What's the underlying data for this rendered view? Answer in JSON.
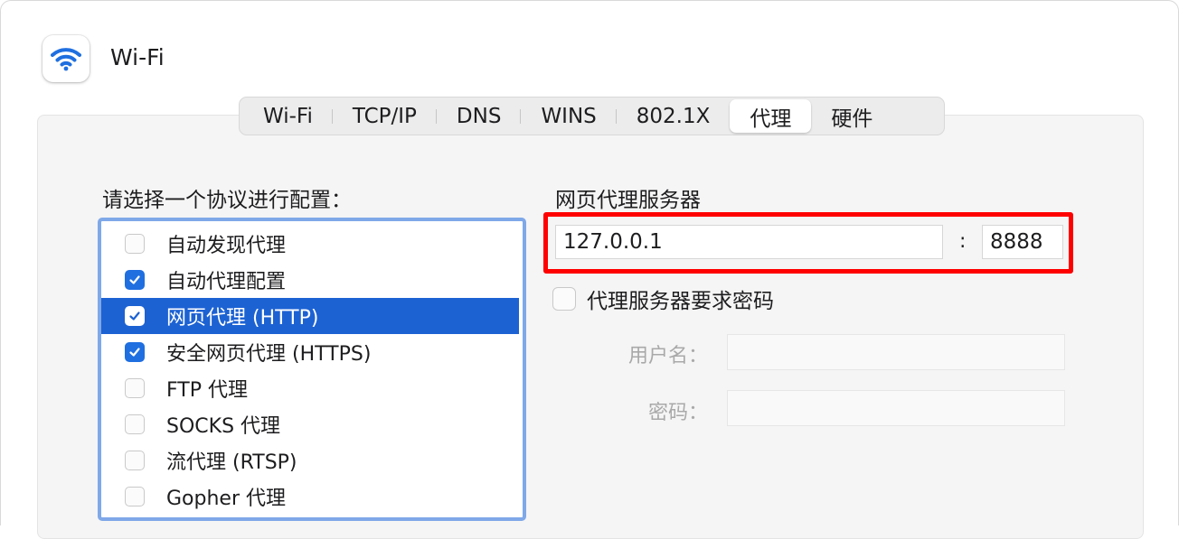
{
  "header": {
    "title": "Wi-Fi",
    "icon": "wifi-icon",
    "accent": "#1f6fe0"
  },
  "tabs": [
    {
      "label": "Wi-Fi",
      "active": false
    },
    {
      "label": "TCP/IP",
      "active": false
    },
    {
      "label": "DNS",
      "active": false
    },
    {
      "label": "WINS",
      "active": false
    },
    {
      "label": "802.1X",
      "active": false
    },
    {
      "label": "代理",
      "active": true
    },
    {
      "label": "硬件",
      "active": false
    }
  ],
  "protocol_list": {
    "label": "请选择一个协议进行配置：",
    "items": [
      {
        "label": "自动发现代理",
        "checked": false,
        "selected": false
      },
      {
        "label": "自动代理配置",
        "checked": true,
        "selected": false
      },
      {
        "label": "网页代理 (HTTP)",
        "checked": true,
        "selected": true
      },
      {
        "label": "安全网页代理 (HTTPS)",
        "checked": true,
        "selected": false
      },
      {
        "label": "FTP 代理",
        "checked": false,
        "selected": false
      },
      {
        "label": "SOCKS 代理",
        "checked": false,
        "selected": false
      },
      {
        "label": "流代理 (RTSP)",
        "checked": false,
        "selected": false
      },
      {
        "label": "Gopher 代理",
        "checked": false,
        "selected": false
      }
    ]
  },
  "proxy_server": {
    "label": "网页代理服务器",
    "host": "127.0.0.1",
    "separator": ":",
    "port": "8888",
    "highlight_color": "#ff0000"
  },
  "auth": {
    "label": "代理服务器要求密码",
    "checked": false,
    "username_label": "用户名：",
    "username_value": "",
    "password_label": "密码：",
    "password_value": ""
  }
}
